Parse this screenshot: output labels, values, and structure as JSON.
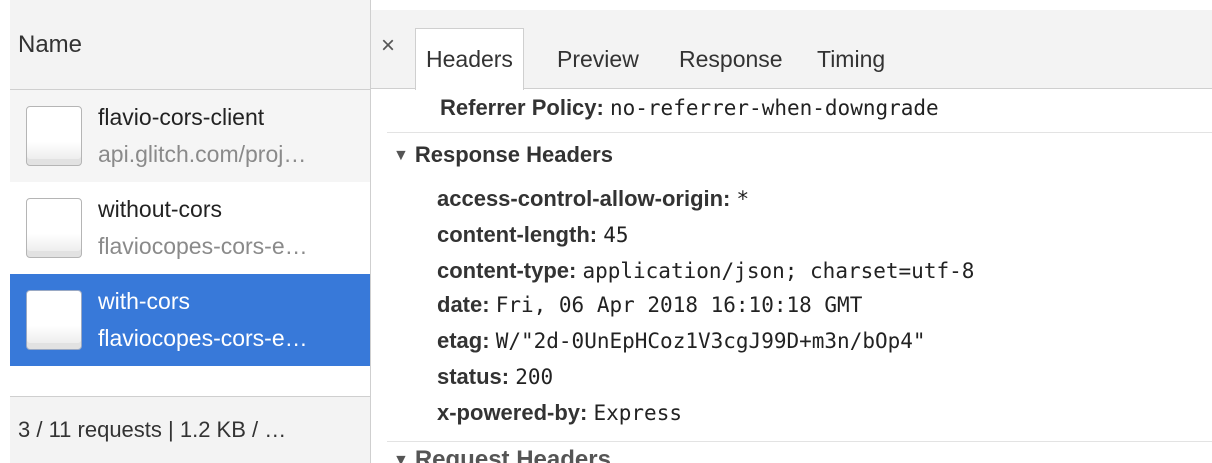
{
  "network": {
    "name_header": "Name",
    "requests": [
      {
        "name": "flavio-cors-client",
        "url": "api.glitch.com/proj…"
      },
      {
        "name": "without-cors",
        "url": "flaviocopes-cors-e…"
      },
      {
        "name": "with-cors",
        "url": "flaviocopes-cors-e…"
      }
    ],
    "summary": "3 / 11 requests | 1.2 KB / …"
  },
  "details": {
    "close_glyph": "×",
    "tabs": [
      "Headers",
      "Preview",
      "Response",
      "Timing"
    ],
    "referrer": {
      "key": "Referrer Policy:",
      "value": "no-referrer-when-downgrade"
    },
    "response_headers": {
      "title": "Response Headers",
      "toggle": "▼",
      "items": [
        {
          "key": "access-control-allow-origin:",
          "value": "*"
        },
        {
          "key": "content-length:",
          "value": "45"
        },
        {
          "key": "content-type:",
          "value": "application/json; charset=utf-8"
        },
        {
          "key": "date:",
          "value": "Fri, 06 Apr 2018 16:10:18 GMT"
        },
        {
          "key": "etag:",
          "value": "W/\"2d-0UnEpHCoz1V3cgJ99D+m3n/bOp4\""
        },
        {
          "key": "status:",
          "value": "200"
        },
        {
          "key": "x-powered-by:",
          "value": "Express"
        }
      ]
    },
    "request_headers": {
      "title": "Request Headers",
      "toggle": "▼"
    }
  },
  "colors": {
    "selected_row": "#3879d9",
    "panel_header": "#f3f3f3",
    "border": "#cfcfcf"
  }
}
